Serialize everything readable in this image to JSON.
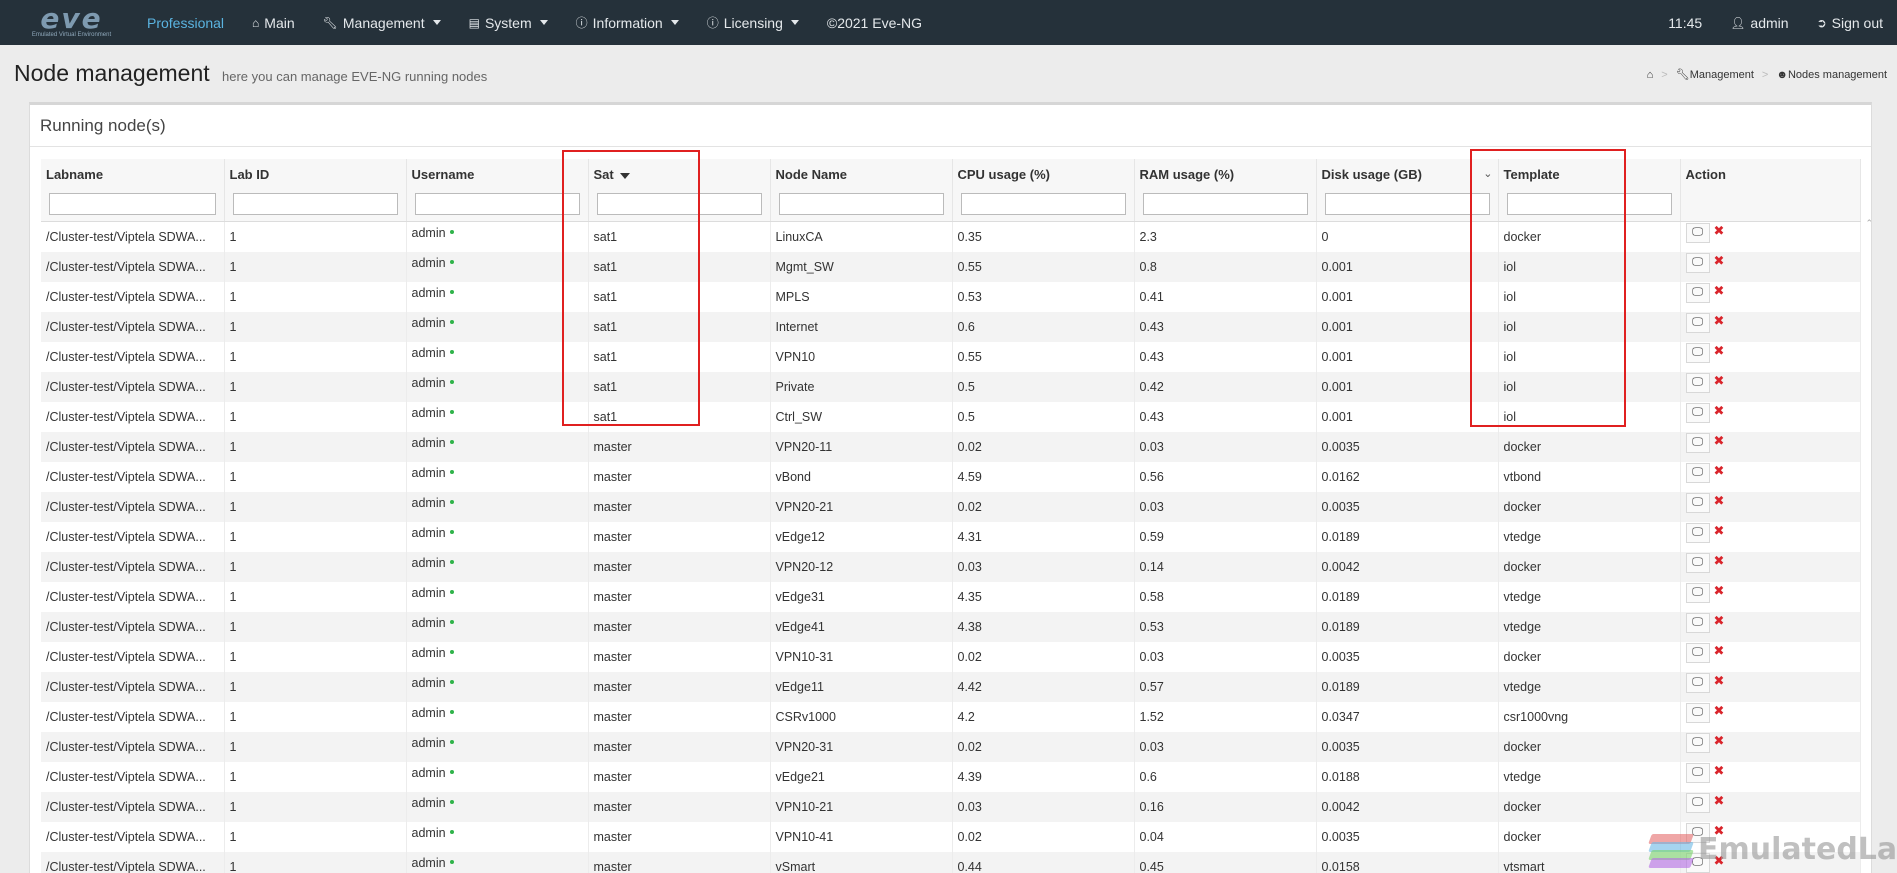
{
  "navbar": {
    "brand": "eve",
    "brand_sub": "Emulated Virtual Environment",
    "items": [
      {
        "label": "Professional",
        "icon": "",
        "caret": false,
        "active": true
      },
      {
        "label": "Main",
        "icon": "home-icon",
        "caret": false
      },
      {
        "label": "Management",
        "icon": "wrench-icon",
        "caret": true
      },
      {
        "label": "System",
        "icon": "book-icon",
        "caret": true
      },
      {
        "label": "Information",
        "icon": "info-icon",
        "caret": true
      },
      {
        "label": "Licensing",
        "icon": "info-icon",
        "caret": true
      },
      {
        "label": "©2021 Eve-NG",
        "icon": "",
        "caret": false
      }
    ],
    "time": "11:45",
    "user": "admin",
    "signout": "Sign out"
  },
  "page": {
    "title": "Node management",
    "subtitle": "here you can manage EVE-NG running nodes",
    "breadcrumb": [
      "Management",
      "Nodes management"
    ]
  },
  "panel": {
    "heading": "Running node(s)"
  },
  "table": {
    "columns": [
      "Labname",
      "Lab ID",
      "Username",
      "Sat",
      "Node Name",
      "CPU usage (%)",
      "RAM usage (%)",
      "Disk usage (GB)",
      "Template",
      "Action"
    ],
    "rows": [
      [
        "/Cluster-test/Viptela SDWA...",
        "1",
        "admin",
        "sat1",
        "LinuxCA",
        "0.35",
        "2.3",
        "0",
        "docker"
      ],
      [
        "/Cluster-test/Viptela SDWA...",
        "1",
        "admin",
        "sat1",
        "Mgmt_SW",
        "0.55",
        "0.8",
        "0.001",
        "iol"
      ],
      [
        "/Cluster-test/Viptela SDWA...",
        "1",
        "admin",
        "sat1",
        "MPLS",
        "0.53",
        "0.41",
        "0.001",
        "iol"
      ],
      [
        "/Cluster-test/Viptela SDWA...",
        "1",
        "admin",
        "sat1",
        "Internet",
        "0.6",
        "0.43",
        "0.001",
        "iol"
      ],
      [
        "/Cluster-test/Viptela SDWA...",
        "1",
        "admin",
        "sat1",
        "VPN10",
        "0.55",
        "0.43",
        "0.001",
        "iol"
      ],
      [
        "/Cluster-test/Viptela SDWA...",
        "1",
        "admin",
        "sat1",
        "Private",
        "0.5",
        "0.42",
        "0.001",
        "iol"
      ],
      [
        "/Cluster-test/Viptela SDWA...",
        "1",
        "admin",
        "sat1",
        "Ctrl_SW",
        "0.5",
        "0.43",
        "0.001",
        "iol"
      ],
      [
        "/Cluster-test/Viptela SDWA...",
        "1",
        "admin",
        "master",
        "VPN20-11",
        "0.02",
        "0.03",
        "0.0035",
        "docker"
      ],
      [
        "/Cluster-test/Viptela SDWA...",
        "1",
        "admin",
        "master",
        "vBond",
        "4.59",
        "0.56",
        "0.0162",
        "vtbond"
      ],
      [
        "/Cluster-test/Viptela SDWA...",
        "1",
        "admin",
        "master",
        "VPN20-21",
        "0.02",
        "0.03",
        "0.0035",
        "docker"
      ],
      [
        "/Cluster-test/Viptela SDWA...",
        "1",
        "admin",
        "master",
        "vEdge12",
        "4.31",
        "0.59",
        "0.0189",
        "vtedge"
      ],
      [
        "/Cluster-test/Viptela SDWA...",
        "1",
        "admin",
        "master",
        "VPN20-12",
        "0.03",
        "0.14",
        "0.0042",
        "docker"
      ],
      [
        "/Cluster-test/Viptela SDWA...",
        "1",
        "admin",
        "master",
        "vEdge31",
        "4.35",
        "0.58",
        "0.0189",
        "vtedge"
      ],
      [
        "/Cluster-test/Viptela SDWA...",
        "1",
        "admin",
        "master",
        "vEdge41",
        "4.38",
        "0.53",
        "0.0189",
        "vtedge"
      ],
      [
        "/Cluster-test/Viptela SDWA...",
        "1",
        "admin",
        "master",
        "VPN10-31",
        "0.02",
        "0.03",
        "0.0035",
        "docker"
      ],
      [
        "/Cluster-test/Viptela SDWA...",
        "1",
        "admin",
        "master",
        "vEdge11",
        "4.42",
        "0.57",
        "0.0189",
        "vtedge"
      ],
      [
        "/Cluster-test/Viptela SDWA...",
        "1",
        "admin",
        "master",
        "CSRv1000",
        "4.2",
        "1.52",
        "0.0347",
        "csr1000vng"
      ],
      [
        "/Cluster-test/Viptela SDWA...",
        "1",
        "admin",
        "master",
        "VPN20-31",
        "0.02",
        "0.03",
        "0.0035",
        "docker"
      ],
      [
        "/Cluster-test/Viptela SDWA...",
        "1",
        "admin",
        "master",
        "vEdge21",
        "4.39",
        "0.6",
        "0.0188",
        "vtedge"
      ],
      [
        "/Cluster-test/Viptela SDWA...",
        "1",
        "admin",
        "master",
        "VPN10-21",
        "0.03",
        "0.16",
        "0.0042",
        "docker"
      ],
      [
        "/Cluster-test/Viptela SDWA...",
        "1",
        "admin",
        "master",
        "VPN10-41",
        "0.02",
        "0.04",
        "0.0035",
        "docker"
      ],
      [
        "/Cluster-test/Viptela SDWA...",
        "1",
        "admin",
        "master",
        "vSmart",
        "0.44",
        "0.45",
        "0.0158",
        "vtsmart"
      ]
    ]
  },
  "watermark": "EmulatedLab",
  "colors": {
    "navbar": "#25313a",
    "highlight": "#e02020",
    "online": "#2fb34a",
    "delete": "#d9242b"
  }
}
